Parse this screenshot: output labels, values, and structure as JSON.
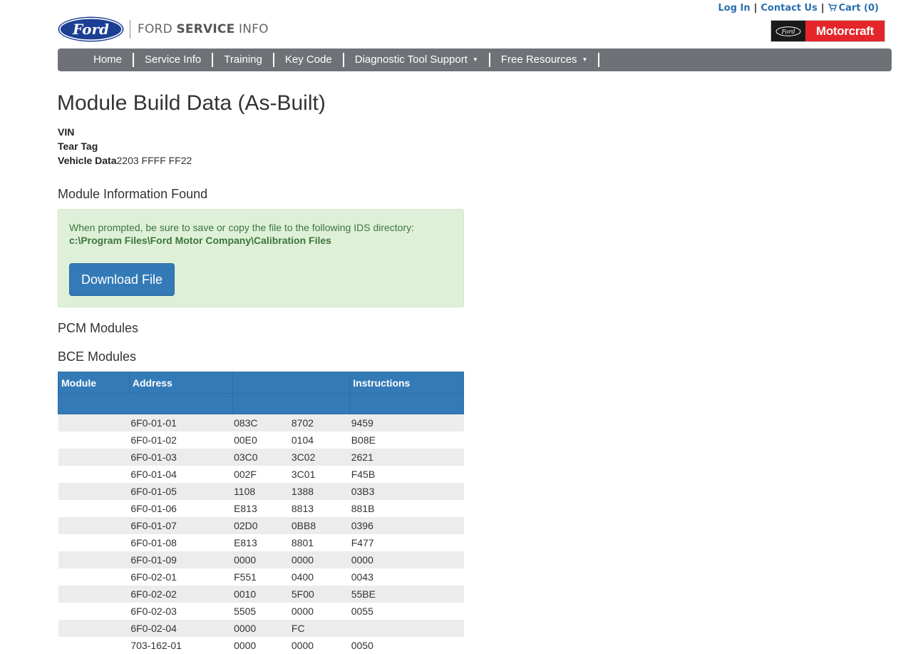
{
  "header": {
    "links": {
      "login": "Log In",
      "contact": "Contact Us",
      "cart": "Cart (0)"
    },
    "brand_light": "FORD ",
    "brand_bold": "SERVICE",
    "brand_tail": " INFO",
    "ford_logo_text": "Ford",
    "motorcraft": "Motorcraft"
  },
  "nav": {
    "items": [
      {
        "label": "Home"
      },
      {
        "label": "Service Info"
      },
      {
        "label": "Training"
      },
      {
        "label": "Key Code"
      },
      {
        "label": "Diagnostic Tool Support"
      },
      {
        "label": "Free Resources"
      }
    ],
    "caret": "▼"
  },
  "page": {
    "title": "Module Build Data (As-Built)",
    "vin_label": "VIN",
    "tear_tag_label": "Tear Tag",
    "vehicle_data_label": "Vehicle Data",
    "vehicle_data_value": "2203 FFFF FF22"
  },
  "module_info": {
    "heading": "Module Information Found",
    "instruction": "When prompted, be sure to save or copy the file to the following IDS directory:",
    "path": "c:\\Program Files\\Ford Motor Company\\Calibration Files",
    "download_label": "Download File"
  },
  "pcm": {
    "heading": "PCM Modules"
  },
  "bce": {
    "heading": "BCE Modules",
    "columns": [
      "Module",
      "Address",
      "",
      "Instructions"
    ],
    "rows": [
      [
        "",
        "6F0-01-01",
        "083C",
        "8702",
        "9459"
      ],
      [
        "",
        "6F0-01-02",
        "00E0",
        "0104",
        "B08E"
      ],
      [
        "",
        "6F0-01-03",
        "03C0",
        "3C02",
        "2621"
      ],
      [
        "",
        "6F0-01-04",
        "002F",
        "3C01",
        "F45B"
      ],
      [
        "",
        "6F0-01-05",
        "1108",
        "1388",
        "03B3"
      ],
      [
        "",
        "6F0-01-06",
        "E813",
        "8813",
        "881B"
      ],
      [
        "",
        "6F0-01-07",
        "02D0",
        "0BB8",
        "0396"
      ],
      [
        "",
        "6F0-01-08",
        "E813",
        "8801",
        "F477"
      ],
      [
        "",
        "6F0-01-09",
        "0000",
        "0000",
        "0000"
      ],
      [
        "",
        "6F0-02-01",
        "F551",
        "0400",
        "0043"
      ],
      [
        "",
        "6F0-02-02",
        "0010",
        "5F00",
        "55BE"
      ],
      [
        "",
        "6F0-02-03",
        "5505",
        "0000",
        "0055"
      ],
      [
        "",
        "6F0-02-04",
        "0000",
        "FC",
        ""
      ],
      [
        "",
        "703-162-01",
        "0000",
        "0000",
        "0050"
      ]
    ]
  },
  "colors": {
    "nav_bg": "#6e7277",
    "link": "#2a6fb0",
    "primary": "#337ab7",
    "alert_bg": "#dff0d8",
    "alert_text": "#3c763d",
    "motorcraft_red": "#e4262b"
  },
  "icons": [
    "cart-icon",
    "ford-oval-logo",
    "caret-down-icon"
  ]
}
